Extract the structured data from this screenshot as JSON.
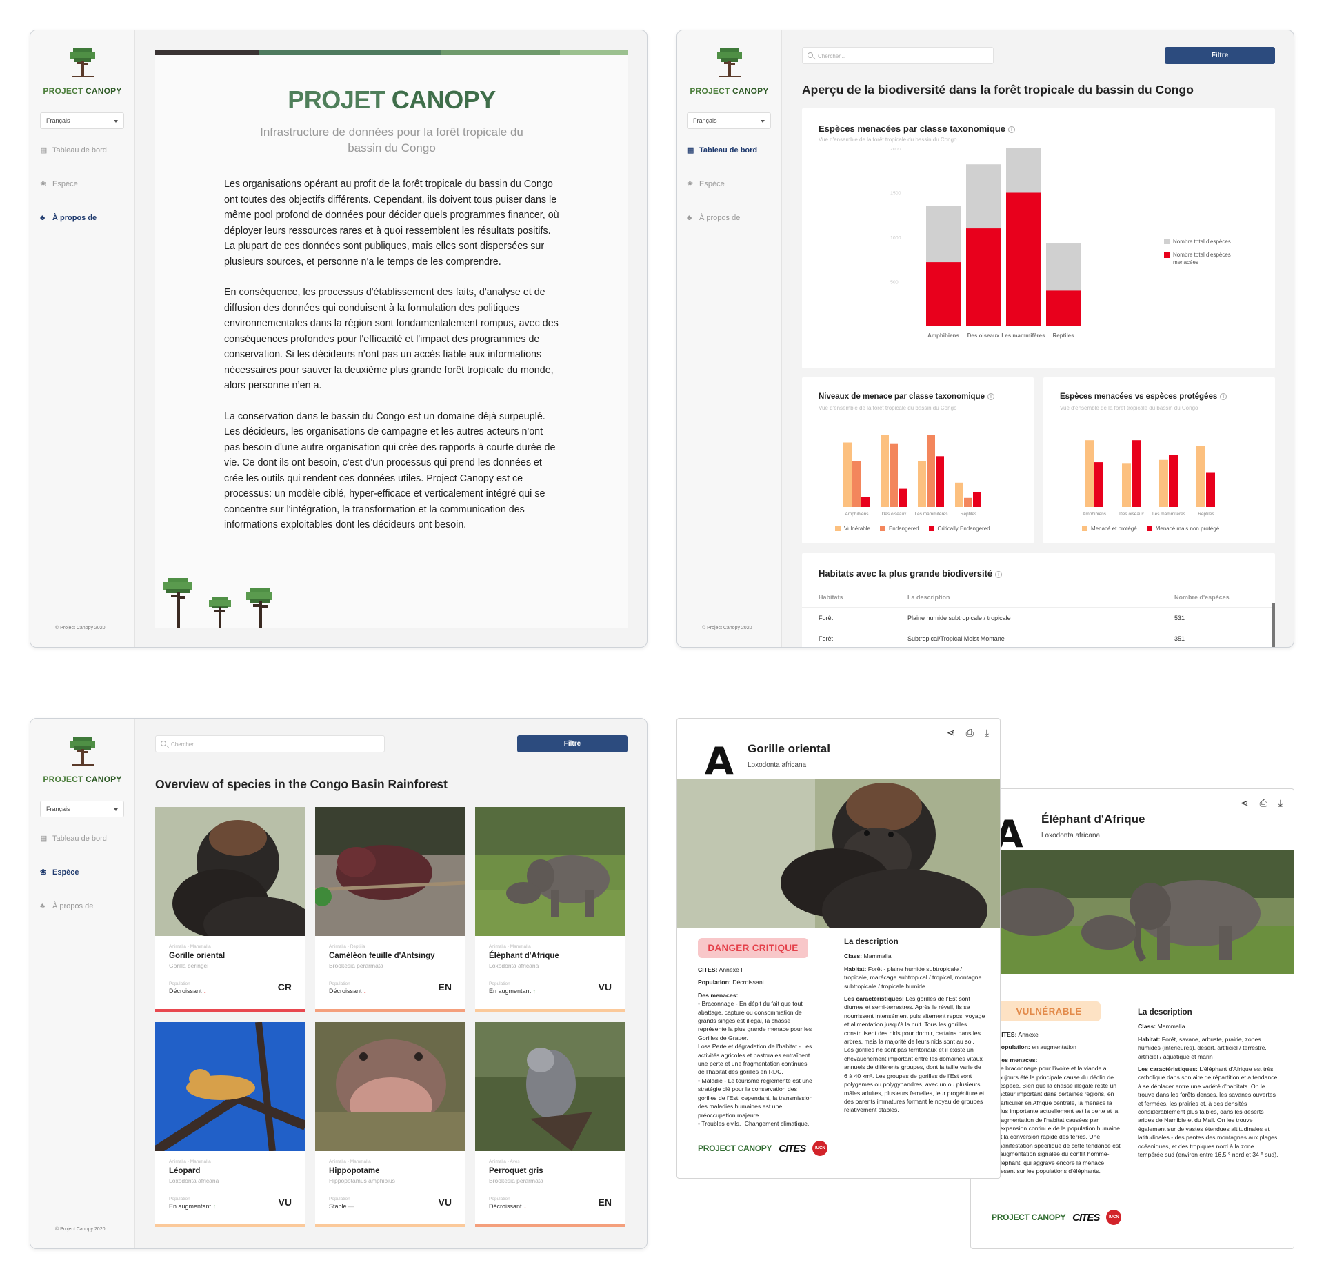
{
  "brand": {
    "logo_text_1": "PROJECT ",
    "logo_text_2": "CANOPY",
    "copyright": "© Project Canopy 2020"
  },
  "sidebar": {
    "language": "Français",
    "items": [
      {
        "label": "Tableau de bord",
        "icon": "grid-icon"
      },
      {
        "label": "Espèce",
        "icon": "paw-icon"
      },
      {
        "label": "À propos de",
        "icon": "tree-icon"
      }
    ]
  },
  "about": {
    "title_1": "PROJET ",
    "title_2": "CANOPY",
    "subtitle": "Infrastructure de données pour la forêt tropicale du bassin du Congo",
    "paragraphs": [
      "Les organisations opérant au profit de la forêt tropicale du bassin du Congo ont toutes des objectifs différents. Cependant, ils doivent tous puiser dans le même pool profond de données pour décider quels programmes financer, où déployer leurs ressources rares et à quoi ressemblent les résultats positifs. La plupart de ces données sont publiques, mais elles sont dispersées sur plusieurs sources, et personne n'a le temps de les comprendre.",
      "En conséquence, les processus d'établissement des faits, d'analyse et de diffusion des données qui conduisent à la formulation des politiques environnementales dans la région sont fondamentalement rompus, avec des conséquences profondes pour l'efficacité et l'impact des programmes de conservation. Si les décideurs n’ont pas un accès fiable aux informations nécessaires pour sauver la deuxième plus grande forêt tropicale du monde, alors personne n’en a.",
      "La conservation dans le bassin du Congo est un domaine déjà surpeuplé. Les décideurs, les organisations de campagne et les autres acteurs n'ont pas besoin d'une autre organisation qui crée des rapports à courte durée de vie. Ce dont ils ont besoin, c'est d'un processus qui prend les données et crée les outils qui rendent ces données utiles. Project Canopy est ce processus: un modèle ciblé, hyper-efficace et verticalement intégré qui se concentre sur l'intégration, la transformation et la communication des informations exploitables dont les décideurs ont besoin."
    ],
    "stripe_colors": [
      "#3a3333",
      "#4e7a5e",
      "#6f9a6c",
      "#9bc08f"
    ]
  },
  "dashboard": {
    "search_placeholder": "Chercher...",
    "filter_label": "Filtre",
    "title": "Aperçu de la biodiversité dans la forêt tropicale du bassin du Congo",
    "threatened": {
      "title": "Espèces menacées par classe taxonomique",
      "subtitle": "Vue d'ensemble de la forêt tropicale du bassin du Congo",
      "legend_total": "Nombre total d'espèces",
      "legend_threat": "Nombre total d'espèces menacées"
    },
    "levels": {
      "title": "Niveaux de menace par classe taxonomique",
      "subtitle": "Vue d'ensemble de la forêt tropicale du bassin du Congo",
      "legend": [
        "Vulnérable",
        "Endangered",
        "Critically Endangered"
      ]
    },
    "protected": {
      "title": "Espèces menacées vs espèces protégées",
      "subtitle": "Vue d'ensemble de la forêt tropicale du bassin du Congo",
      "legend": [
        "Menacé et protégé",
        "Menacé mais non protégé"
      ]
    },
    "habitats": {
      "title": "Habitats avec la plus grande biodiversité",
      "headers": [
        "Habitats",
        "La description",
        "Nombre d'espèces"
      ],
      "rows": [
        {
          "habitat": "Forêt",
          "description": "Plaine humide subtropicale / tropicale",
          "count": "531"
        },
        {
          "habitat": "Forêt",
          "description": "Subtropical/Tropical Moist Montane",
          "count": "351"
        }
      ]
    }
  },
  "chart_data": [
    {
      "type": "bar",
      "title": "Espèces menacées par classe taxonomique",
      "categories": [
        "Amphibiens",
        "Des oiseaux",
        "Les mammifères",
        "Reptiles"
      ],
      "ylim": [
        0,
        2000
      ],
      "series": [
        {
          "name": "Nombre total d'espèces",
          "values": [
            1350,
            1820,
            2000,
            930
          ]
        },
        {
          "name": "Nombre total d'espèces menacées",
          "values": [
            720,
            1100,
            1500,
            400
          ]
        }
      ],
      "colors": [
        "#d0d0d0",
        "#e8001c"
      ]
    },
    {
      "type": "bar",
      "title": "Niveaux de menace par classe taxonomique",
      "categories": [
        "Amphibiens",
        "Des oiseaux",
        "Les mammifères",
        "Reptiles"
      ],
      "series": [
        {
          "name": "Vulnérable",
          "values": [
            85,
            95,
            60,
            32
          ]
        },
        {
          "name": "Endangered",
          "values": [
            60,
            83,
            95,
            12
          ]
        },
        {
          "name": "Critically Endangered",
          "values": [
            13,
            24,
            67,
            20
          ]
        }
      ],
      "colors": [
        "#fcc07f",
        "#f3865c",
        "#e8001c"
      ]
    },
    {
      "type": "bar",
      "title": "Espèces menacées vs espèces protégées",
      "categories": [
        "Amphibiens",
        "Des oiseaux",
        "Les mammifères",
        "Reptiles"
      ],
      "series": [
        {
          "name": "Menacé et protégé",
          "values": [
            88,
            57,
            62,
            80
          ]
        },
        {
          "name": "Menacé mais non protégé",
          "values": [
            59,
            88,
            69,
            45
          ]
        }
      ],
      "colors": [
        "#fcc07f",
        "#e8001c"
      ]
    }
  ],
  "species_page": {
    "search_placeholder": "Chercher...",
    "filter_label": "Filtre",
    "title": "Overview of species in the Congo Basin Rainforest",
    "population_label": "Population",
    "cards": [
      {
        "tax": "Animalia - Mammalia",
        "name": "Gorille oriental",
        "sci": "Gorilla beringei",
        "pop": "Décroissant",
        "trend": "down",
        "code": "CR",
        "bar": "#e8484f",
        "photo": "gorilla"
      },
      {
        "tax": "Animalia - Reptilia",
        "name": "Caméléon feuille d'Antsingy",
        "sci": "Brookesia perarmata",
        "pop": "Décroissant",
        "trend": "down",
        "code": "EN",
        "bar": "#f49f7c",
        "photo": "chameleon"
      },
      {
        "tax": "Animalia - Mammalia",
        "name": "Éléphant d'Afrique",
        "sci": "Loxodonta africana",
        "pop": "En augmentant",
        "trend": "up",
        "code": "VU",
        "bar": "#fbc99a",
        "photo": "elephant"
      },
      {
        "tax": "Animalia - Mammalia",
        "name": "Léopard",
        "sci": "Loxodonta africana",
        "pop": "En augmentant",
        "trend": "up",
        "code": "VU",
        "bar": "#fbc99a",
        "photo": "leopard"
      },
      {
        "tax": "Animalia - Mammalia",
        "name": "Hippopotame",
        "sci": "Hippopotamus amphibius",
        "pop": "Stable",
        "trend": "flat",
        "code": "VU",
        "bar": "#fbc99a",
        "photo": "hippo"
      },
      {
        "tax": "Animalia - Aves",
        "name": "Perroquet gris",
        "sci": "Brookesia perarmata",
        "pop": "Décroissant",
        "trend": "down",
        "code": "EN",
        "bar": "#f49f7c",
        "photo": "parrot"
      }
    ]
  },
  "sheet_gorilla": {
    "letter": "A",
    "name": "Gorille oriental",
    "sci": "Loxodonta africana",
    "badge": "DANGER CRITIQUE",
    "cites_label": "CITES:",
    "cites_value": "Annexe I",
    "population_label": "Population:",
    "population_value": "Décroissant",
    "threats_label": "Des menaces:",
    "threats": "•  Braconnage - En dépit du fait que tout abattage, capture ou consommation de grands singes est illégal, la chasse représente la plus grande menace pour les Gorilles de Grauer.\nLoss Perte et dégradation de l'habitat - Les activités agricoles et pastorales entraînent une perte et une fragmentation continues de l'habitat des gorilles en RDC.\n•  Maladie - Le tourisme réglementé est une stratégie clé pour la conservation des gorilles de l'Est; cependant, la transmission des maladies humaines est une préoccupation majeure.\n•  Troubles civils. ·Changement climatique.",
    "desc_title": "La description",
    "class_label": "Class:",
    "class_value": "Mammalia",
    "habitat_label": "Habitat:",
    "habitat_value": "Forêt - plaine humide subtropicale / tropicale, marécage subtropical / tropical, montagne subtropicale / tropicale humide.",
    "features_label": "Les caractéristiques:",
    "features": "Les gorilles de l'Est sont diurnes et semi-terrestres. Après le réveil, ils se nourrissent intensément puis alternent repos, voyage et alimentation jusqu'à la nuit. Tous les gorilles construisent des nids pour dormir, certains dans les arbres, mais la majorité de leurs nids sont au sol. Les gorilles ne sont pas territoriaux et il existe un chevauchement important entre les domaines vitaux annuels de différents groupes, dont la taille varie de 6 à 40 km². Les groupes de gorilles de l'Est sont polygames ou polygynandres, avec un ou plusieurs mâles adultes, plusieurs femelles, leur progéniture et des parents immatures formant le noyau de groupes relativement stables.",
    "logo_pc": "PROJECT CANOPY",
    "logo_cites": "CITES",
    "logo_iucn": "IUCN"
  },
  "sheet_elephant": {
    "letter": "A",
    "name": "Éléphant d'Afrique",
    "sci": "Loxodonta africana",
    "badge": "VULNÉRABLE",
    "cites_label": "CITES:",
    "cites_value": "Annexe I",
    "population_label": "Population:",
    "population_value": "en augmentation",
    "threats_label": "Des menaces:",
    "threats": "Le braconnage pour l'ivoire et la viande a toujours été la principale cause du déclin de l'espèce. Bien que la chasse illégale reste un facteur important dans certaines régions, en particulier en Afrique centrale, la menace la plus importante actuellement est la perte et la fragmentation de l'habitat causées par l'expansion continue de la population humaine et la conversion rapide des terres. Une manifestation spécifique de cette tendance est l'augmentation signalée du conflit homme-éléphant, qui aggrave encore la menace pesant sur les populations d'éléphants.",
    "desc_title": "La description",
    "class_label": "Class:",
    "class_value": "Mammalia",
    "habitat_label": "Habitat:",
    "habitat_value": "Forêt, savane, arbuste, prairie, zones humides (intérieures), désert, artificiel / terrestre, artificiel / aquatique et marin",
    "features_label": "Les caractéristiques:",
    "features": "L'éléphant d'Afrique est très catholique dans son aire de répartition et a tendance à se déplacer entre une variété d'habitats. On le trouve dans les forêts denses, les savanes ouvertes et fermées, les prairies et, à des densités considérablement plus faibles, dans les déserts arides de Namibie et du Mali. On les trouve également sur de vastes étendues altitudinales et latitudinales - des pentes des montagnes aux plages océaniques, et des tropiques nord à la zone tempérée sud (environ entre 16,5 ° nord et 34 ° sud).",
    "logo_pc": "PROJECT CANOPY",
    "logo_cites": "CITES",
    "logo_iucn": "IUCN"
  }
}
